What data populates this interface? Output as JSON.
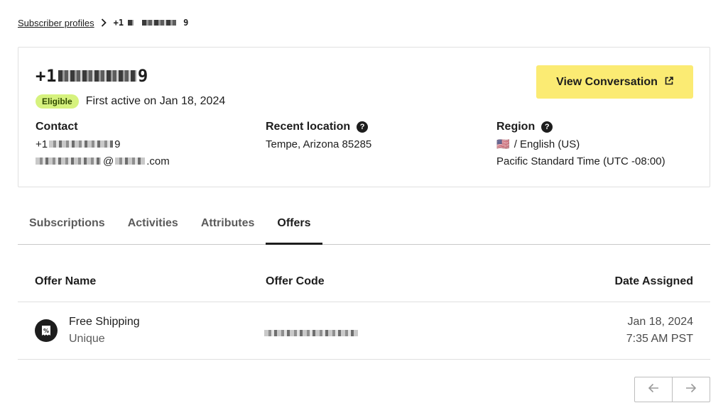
{
  "breadcrumb": {
    "parent_label": "Subscriber profiles",
    "current_prefix": "+1",
    "current_suffix": "9"
  },
  "profile": {
    "phone_prefix": "+1",
    "phone_suffix": "9",
    "status_badge": "Eligible",
    "first_active": "First active on Jan 18, 2024",
    "view_button_label": "View Conversation"
  },
  "contact": {
    "label": "Contact",
    "phone_prefix": "+1",
    "phone_suffix": "9",
    "email_at": "@",
    "email_tld": ".com"
  },
  "location": {
    "label": "Recent location",
    "value": "Tempe, Arizona 85285"
  },
  "region": {
    "label": "Region",
    "flag": "🇺🇸",
    "language": "/ English (US)",
    "timezone": "Pacific Standard Time (UTC -08:00)"
  },
  "tabs": [
    {
      "label": "Subscriptions",
      "active": false
    },
    {
      "label": "Activities",
      "active": false
    },
    {
      "label": "Attributes",
      "active": false
    },
    {
      "label": "Offers",
      "active": true
    }
  ],
  "table": {
    "headers": {
      "name": "Offer Name",
      "code": "Offer Code",
      "date": "Date Assigned"
    },
    "rows": [
      {
        "icon": "discount-tag-icon",
        "name": "Free Shipping",
        "type": "Unique",
        "date": "Jan 18, 2024",
        "time": "7:35 AM PST"
      }
    ]
  },
  "pagination": {
    "prev_icon": "arrow-left-icon",
    "next_icon": "arrow-right-icon"
  },
  "colors": {
    "accent_button": "#fbeb73",
    "badge_bg": "#d6f27e",
    "text": "#1d1d1d"
  }
}
